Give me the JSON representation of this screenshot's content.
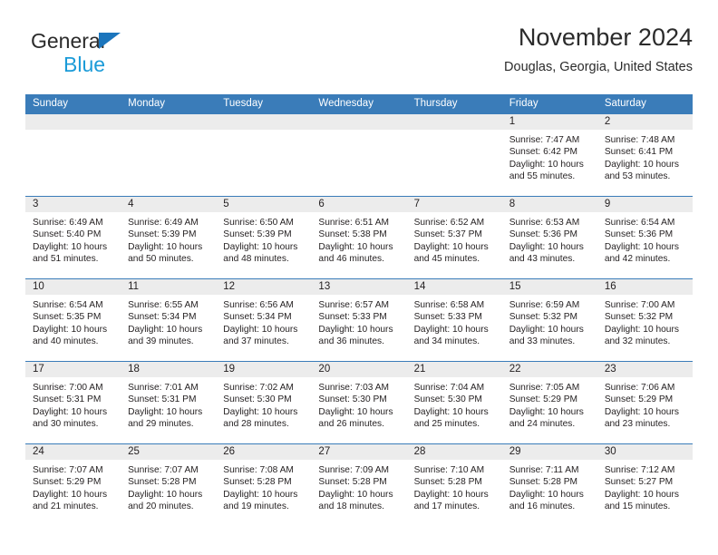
{
  "brand": {
    "name_part1": "General",
    "name_part2": "Blue",
    "triangle_color": "#1b75bc",
    "blue_text_color": "#1b9bd8"
  },
  "header": {
    "title": "November 2024",
    "subtitle": "Douglas, Georgia, United States"
  },
  "theme": {
    "header_blue": "#3a7cb9",
    "daynum_band": "#ececec",
    "text": "#231f20"
  },
  "calendar": {
    "weekday_headers": [
      "Sunday",
      "Monday",
      "Tuesday",
      "Wednesday",
      "Thursday",
      "Friday",
      "Saturday"
    ],
    "weeks": [
      [
        {
          "day": "",
          "sunrise": "",
          "sunset": "",
          "daylight_line1": "",
          "daylight_line2": ""
        },
        {
          "day": "",
          "sunrise": "",
          "sunset": "",
          "daylight_line1": "",
          "daylight_line2": ""
        },
        {
          "day": "",
          "sunrise": "",
          "sunset": "",
          "daylight_line1": "",
          "daylight_line2": ""
        },
        {
          "day": "",
          "sunrise": "",
          "sunset": "",
          "daylight_line1": "",
          "daylight_line2": ""
        },
        {
          "day": "",
          "sunrise": "",
          "sunset": "",
          "daylight_line1": "",
          "daylight_line2": ""
        },
        {
          "day": "1",
          "sunrise": "Sunrise: 7:47 AM",
          "sunset": "Sunset: 6:42 PM",
          "daylight_line1": "Daylight: 10 hours",
          "daylight_line2": "and 55 minutes."
        },
        {
          "day": "2",
          "sunrise": "Sunrise: 7:48 AM",
          "sunset": "Sunset: 6:41 PM",
          "daylight_line1": "Daylight: 10 hours",
          "daylight_line2": "and 53 minutes."
        }
      ],
      [
        {
          "day": "3",
          "sunrise": "Sunrise: 6:49 AM",
          "sunset": "Sunset: 5:40 PM",
          "daylight_line1": "Daylight: 10 hours",
          "daylight_line2": "and 51 minutes."
        },
        {
          "day": "4",
          "sunrise": "Sunrise: 6:49 AM",
          "sunset": "Sunset: 5:39 PM",
          "daylight_line1": "Daylight: 10 hours",
          "daylight_line2": "and 50 minutes."
        },
        {
          "day": "5",
          "sunrise": "Sunrise: 6:50 AM",
          "sunset": "Sunset: 5:39 PM",
          "daylight_line1": "Daylight: 10 hours",
          "daylight_line2": "and 48 minutes."
        },
        {
          "day": "6",
          "sunrise": "Sunrise: 6:51 AM",
          "sunset": "Sunset: 5:38 PM",
          "daylight_line1": "Daylight: 10 hours",
          "daylight_line2": "and 46 minutes."
        },
        {
          "day": "7",
          "sunrise": "Sunrise: 6:52 AM",
          "sunset": "Sunset: 5:37 PM",
          "daylight_line1": "Daylight: 10 hours",
          "daylight_line2": "and 45 minutes."
        },
        {
          "day": "8",
          "sunrise": "Sunrise: 6:53 AM",
          "sunset": "Sunset: 5:36 PM",
          "daylight_line1": "Daylight: 10 hours",
          "daylight_line2": "and 43 minutes."
        },
        {
          "day": "9",
          "sunrise": "Sunrise: 6:54 AM",
          "sunset": "Sunset: 5:36 PM",
          "daylight_line1": "Daylight: 10 hours",
          "daylight_line2": "and 42 minutes."
        }
      ],
      [
        {
          "day": "10",
          "sunrise": "Sunrise: 6:54 AM",
          "sunset": "Sunset: 5:35 PM",
          "daylight_line1": "Daylight: 10 hours",
          "daylight_line2": "and 40 minutes."
        },
        {
          "day": "11",
          "sunrise": "Sunrise: 6:55 AM",
          "sunset": "Sunset: 5:34 PM",
          "daylight_line1": "Daylight: 10 hours",
          "daylight_line2": "and 39 minutes."
        },
        {
          "day": "12",
          "sunrise": "Sunrise: 6:56 AM",
          "sunset": "Sunset: 5:34 PM",
          "daylight_line1": "Daylight: 10 hours",
          "daylight_line2": "and 37 minutes."
        },
        {
          "day": "13",
          "sunrise": "Sunrise: 6:57 AM",
          "sunset": "Sunset: 5:33 PM",
          "daylight_line1": "Daylight: 10 hours",
          "daylight_line2": "and 36 minutes."
        },
        {
          "day": "14",
          "sunrise": "Sunrise: 6:58 AM",
          "sunset": "Sunset: 5:33 PM",
          "daylight_line1": "Daylight: 10 hours",
          "daylight_line2": "and 34 minutes."
        },
        {
          "day": "15",
          "sunrise": "Sunrise: 6:59 AM",
          "sunset": "Sunset: 5:32 PM",
          "daylight_line1": "Daylight: 10 hours",
          "daylight_line2": "and 33 minutes."
        },
        {
          "day": "16",
          "sunrise": "Sunrise: 7:00 AM",
          "sunset": "Sunset: 5:32 PM",
          "daylight_line1": "Daylight: 10 hours",
          "daylight_line2": "and 32 minutes."
        }
      ],
      [
        {
          "day": "17",
          "sunrise": "Sunrise: 7:00 AM",
          "sunset": "Sunset: 5:31 PM",
          "daylight_line1": "Daylight: 10 hours",
          "daylight_line2": "and 30 minutes."
        },
        {
          "day": "18",
          "sunrise": "Sunrise: 7:01 AM",
          "sunset": "Sunset: 5:31 PM",
          "daylight_line1": "Daylight: 10 hours",
          "daylight_line2": "and 29 minutes."
        },
        {
          "day": "19",
          "sunrise": "Sunrise: 7:02 AM",
          "sunset": "Sunset: 5:30 PM",
          "daylight_line1": "Daylight: 10 hours",
          "daylight_line2": "and 28 minutes."
        },
        {
          "day": "20",
          "sunrise": "Sunrise: 7:03 AM",
          "sunset": "Sunset: 5:30 PM",
          "daylight_line1": "Daylight: 10 hours",
          "daylight_line2": "and 26 minutes."
        },
        {
          "day": "21",
          "sunrise": "Sunrise: 7:04 AM",
          "sunset": "Sunset: 5:30 PM",
          "daylight_line1": "Daylight: 10 hours",
          "daylight_line2": "and 25 minutes."
        },
        {
          "day": "22",
          "sunrise": "Sunrise: 7:05 AM",
          "sunset": "Sunset: 5:29 PM",
          "daylight_line1": "Daylight: 10 hours",
          "daylight_line2": "and 24 minutes."
        },
        {
          "day": "23",
          "sunrise": "Sunrise: 7:06 AM",
          "sunset": "Sunset: 5:29 PM",
          "daylight_line1": "Daylight: 10 hours",
          "daylight_line2": "and 23 minutes."
        }
      ],
      [
        {
          "day": "24",
          "sunrise": "Sunrise: 7:07 AM",
          "sunset": "Sunset: 5:29 PM",
          "daylight_line1": "Daylight: 10 hours",
          "daylight_line2": "and 21 minutes."
        },
        {
          "day": "25",
          "sunrise": "Sunrise: 7:07 AM",
          "sunset": "Sunset: 5:28 PM",
          "daylight_line1": "Daylight: 10 hours",
          "daylight_line2": "and 20 minutes."
        },
        {
          "day": "26",
          "sunrise": "Sunrise: 7:08 AM",
          "sunset": "Sunset: 5:28 PM",
          "daylight_line1": "Daylight: 10 hours",
          "daylight_line2": "and 19 minutes."
        },
        {
          "day": "27",
          "sunrise": "Sunrise: 7:09 AM",
          "sunset": "Sunset: 5:28 PM",
          "daylight_line1": "Daylight: 10 hours",
          "daylight_line2": "and 18 minutes."
        },
        {
          "day": "28",
          "sunrise": "Sunrise: 7:10 AM",
          "sunset": "Sunset: 5:28 PM",
          "daylight_line1": "Daylight: 10 hours",
          "daylight_line2": "and 17 minutes."
        },
        {
          "day": "29",
          "sunrise": "Sunrise: 7:11 AM",
          "sunset": "Sunset: 5:28 PM",
          "daylight_line1": "Daylight: 10 hours",
          "daylight_line2": "and 16 minutes."
        },
        {
          "day": "30",
          "sunrise": "Sunrise: 7:12 AM",
          "sunset": "Sunset: 5:27 PM",
          "daylight_line1": "Daylight: 10 hours",
          "daylight_line2": "and 15 minutes."
        }
      ]
    ]
  }
}
